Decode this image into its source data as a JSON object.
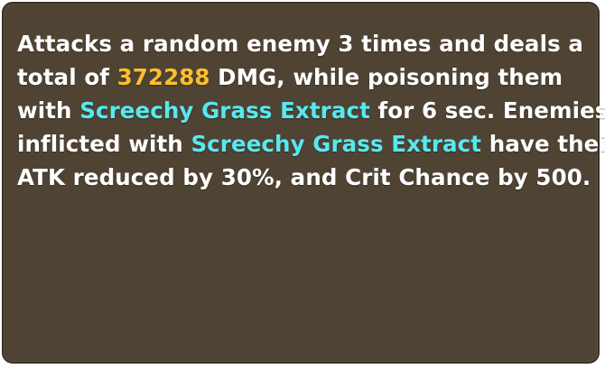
{
  "tooltip": {
    "colors": {
      "background": "#4f4334",
      "text": "#ffffff",
      "damage_value": "#ffbf2a",
      "effect_name": "#57e9ef"
    },
    "line1": "Attacks a random enemy 3 times and deals a",
    "line2_pre": "total of ",
    "damage_value": "372288",
    "line2_post": " DMG, while poisoning them",
    "line3_pre": "with ",
    "effect_name_1": "Screechy Grass Extract",
    "line3_post": " for 6 sec. Enemies",
    "line4_pre": "inflicted with ",
    "effect_name_2": "Screechy Grass Extract",
    "line4_post": " have their",
    "line5": "ATK reduced by 30%, and Crit Chance by 500."
  }
}
